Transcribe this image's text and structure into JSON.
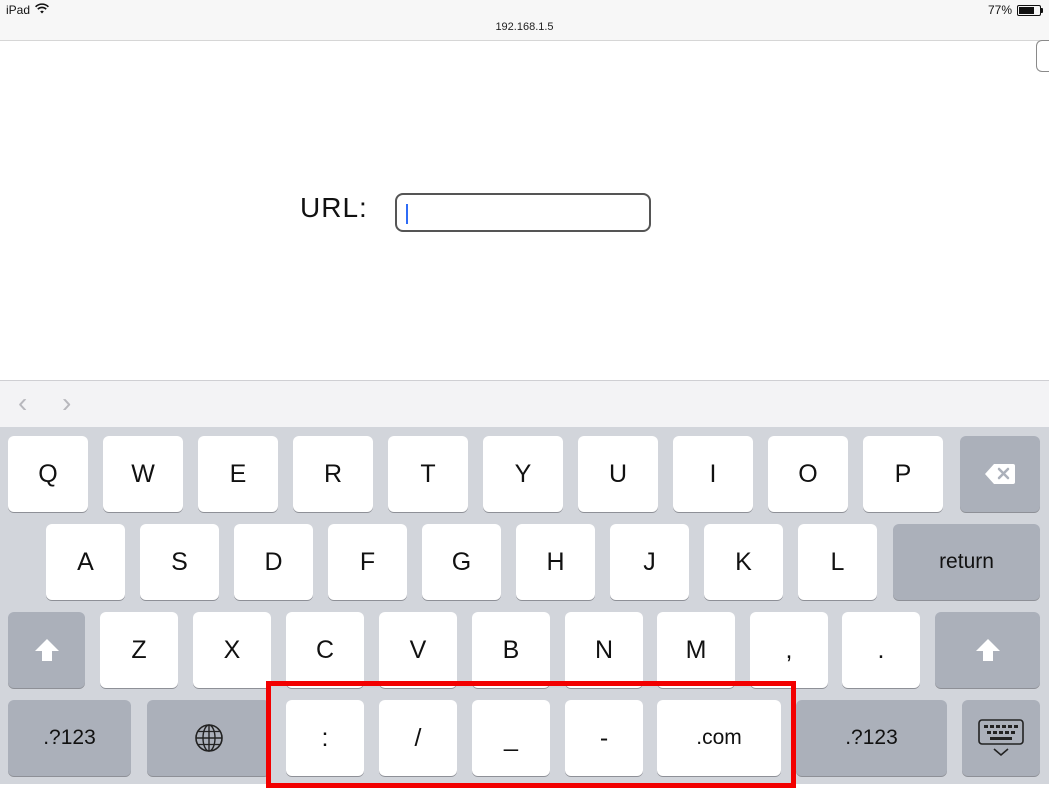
{
  "status_bar": {
    "device": "iPad",
    "url": "192.168.1.5",
    "battery_text": "77%",
    "battery_level": 0.77,
    "wifi_icon": "wifi-icon"
  },
  "page": {
    "url_label": "URL:",
    "url_value": ""
  },
  "accessory_bar": {
    "back_symbol": "‹",
    "forward_symbol": "›"
  },
  "keyboard": {
    "row1": [
      "Q",
      "W",
      "E",
      "R",
      "T",
      "Y",
      "U",
      "I",
      "O",
      "P"
    ],
    "row2": [
      "A",
      "S",
      "D",
      "F",
      "G",
      "H",
      "J",
      "K",
      "L"
    ],
    "return_label": "return",
    "row3": [
      "Z",
      "X",
      "C",
      "V",
      "B",
      "N",
      "M",
      ",",
      "."
    ],
    "numbers_label": ".?123",
    "url_keys": [
      ":",
      "/",
      "_",
      "-",
      ".com"
    ],
    "icons": {
      "delete": "backspace-icon",
      "shift": "shift-icon",
      "globe": "globe-icon",
      "dismiss": "keyboard-dismiss-icon"
    },
    "highlight_color": "#f20000"
  }
}
